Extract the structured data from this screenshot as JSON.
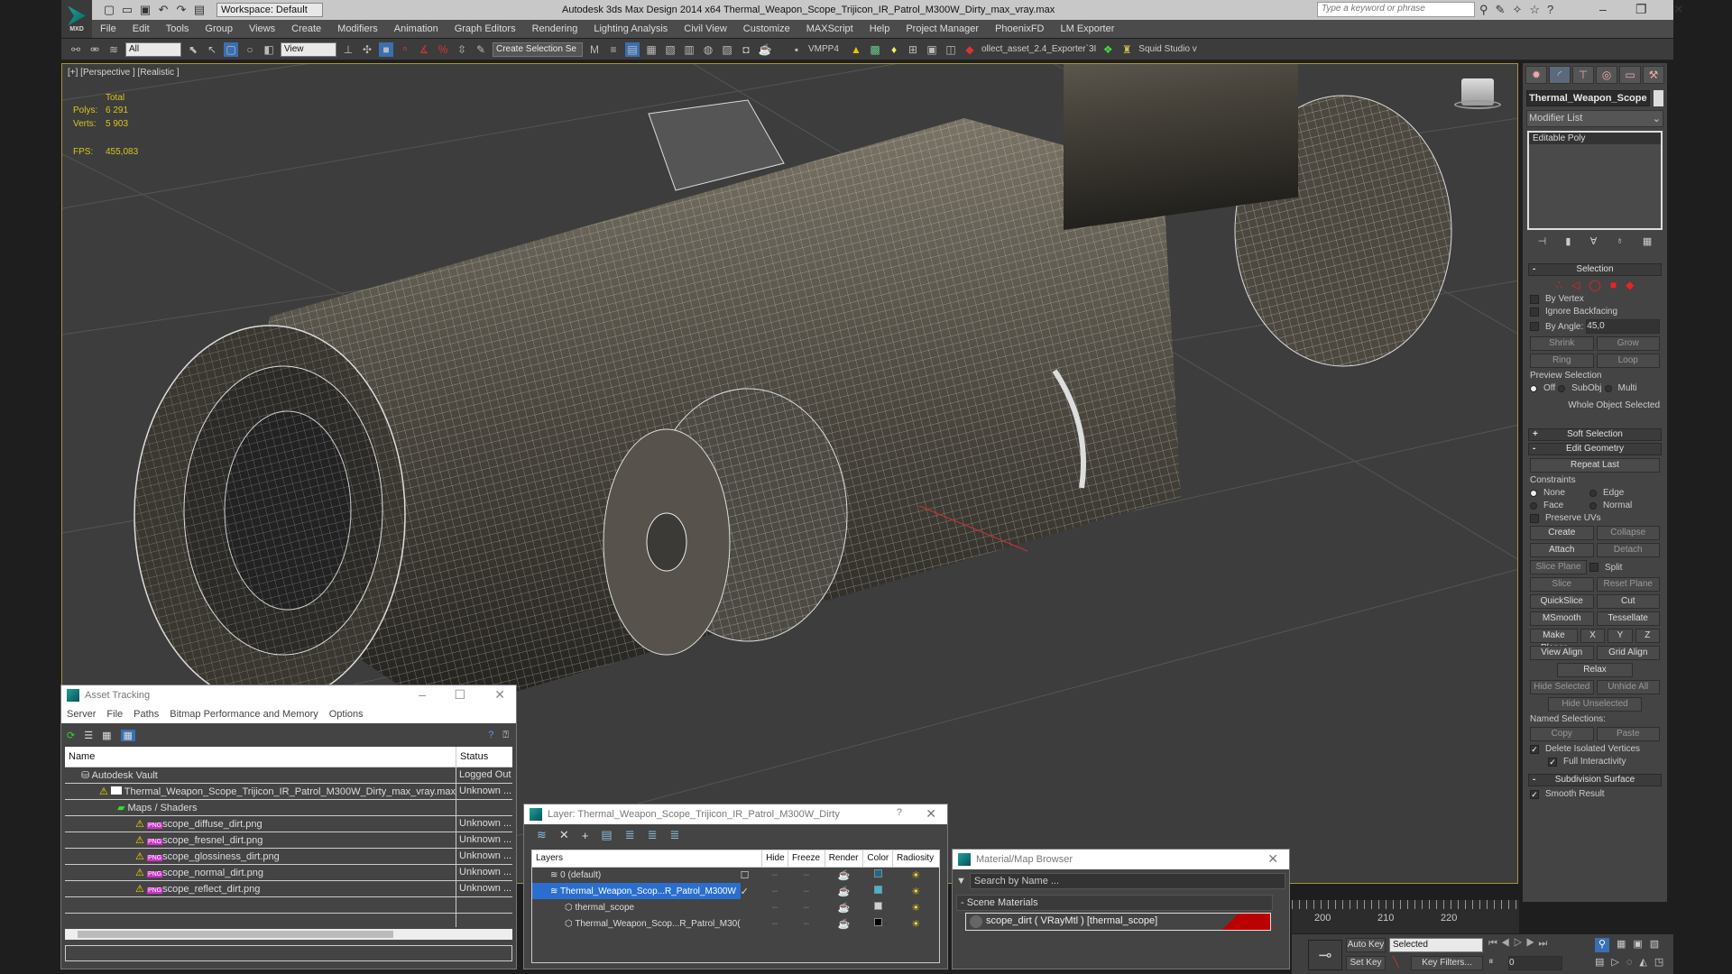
{
  "app": {
    "logo_text": "MXD",
    "workspace": "Workspace: Default",
    "title": "Autodesk 3ds Max Design 2014 x64    Thermal_Weapon_Scope_Trijicon_IR_Patrol_M300W_Dirty_max_vray.max",
    "search_placeholder": "Type a keyword or phrase"
  },
  "menu": [
    "File",
    "Edit",
    "Tools",
    "Group",
    "Views",
    "Create",
    "Modifiers",
    "Animation",
    "Graph Editors",
    "Rendering",
    "Lighting Analysis",
    "Civil View",
    "Customize",
    "MAXScript",
    "Help",
    "Project Manager",
    "PhoenixFD",
    "LM Exporter"
  ],
  "toolbar": {
    "filter": "All",
    "refcoord": "View",
    "selset": "Create Selection Se",
    "vmpp": "VMPP4",
    "exporter": "ollect_asset_2.4_Exporter`3I",
    "squid": "Squid Studio v"
  },
  "viewport": {
    "label": "[+] [Perspective ] [Realistic ]",
    "stats": {
      "total": "Total",
      "polys_label": "Polys:",
      "polys": "6 291",
      "verts_label": "Verts:",
      "verts": "5 903",
      "fps_label": "FPS:",
      "fps": "455,083"
    }
  },
  "command_panel": {
    "object_name": "Thermal_Weapon_Scope",
    "modifier_list": "Modifier List",
    "stack": [
      "Editable Poly"
    ],
    "selection": {
      "title": "Selection",
      "by_vertex": "By Vertex",
      "ignore_backfacing": "Ignore Backfacing",
      "by_angle": "By Angle:",
      "angle": "45,0",
      "shrink": "Shrink",
      "grow": "Grow",
      "ring": "Ring",
      "loop": "Loop",
      "preview": "Preview Selection",
      "off": "Off",
      "subobj": "SubObj",
      "multi": "Multi",
      "status": "Whole Object Selected"
    },
    "soft_selection": "Soft Selection",
    "edit_geometry": {
      "title": "Edit Geometry",
      "repeat_last": "Repeat Last",
      "constraints": "Constraints",
      "none": "None",
      "edge": "Edge",
      "face": "Face",
      "normal": "Normal",
      "preserve_uvs": "Preserve UVs",
      "create": "Create",
      "collapse": "Collapse",
      "attach": "Attach",
      "detach": "Detach",
      "slice_plane": "Slice Plane",
      "split": "Split",
      "slice": "Slice",
      "reset_plane": "Reset Plane",
      "quickslice": "QuickSlice",
      "cut": "Cut",
      "msmooth": "MSmooth",
      "tessellate": "Tessellate",
      "make_planar": "Make Planar",
      "x": "X",
      "y": "Y",
      "z": "Z",
      "view_align": "View Align",
      "grid_align": "Grid Align",
      "relax": "Relax",
      "hide_selected": "Hide Selected",
      "unhide_all": "Unhide All",
      "hide_unselected": "Hide Unselected",
      "named_selections": "Named Selections:",
      "copy": "Copy",
      "paste": "Paste",
      "delete_isolated": "Delete Isolated Vertices",
      "full_interactivity": "Full Interactivity"
    },
    "subdivision": {
      "title": "Subdivision Surface",
      "smooth_result": "Smooth Result"
    }
  },
  "asset_tracking": {
    "title": "Asset Tracking",
    "menu": [
      "Server",
      "File",
      "Paths",
      "Bitmap Performance and Memory",
      "Options"
    ],
    "col_name": "Name",
    "col_status": "Status",
    "rows": [
      {
        "name": "Autodesk Vault",
        "status": "Logged Out",
        "indent": 0
      },
      {
        "name": "Thermal_Weapon_Scope_Trijicon_IR_Patrol_M300W_Dirty_max_vray.max",
        "status": "Unknown ...",
        "indent": 1
      },
      {
        "name": "Maps / Shaders",
        "status": "",
        "indent": 2
      },
      {
        "name": "scope_diffuse_dirt.png",
        "status": "Unknown ...",
        "indent": 3
      },
      {
        "name": "scope_fresnel_dirt.png",
        "status": "Unknown ...",
        "indent": 3
      },
      {
        "name": "scope_glossiness_dirt.png",
        "status": "Unknown ...",
        "indent": 3
      },
      {
        "name": "scope_normal_dirt.png",
        "status": "Unknown ...",
        "indent": 3
      },
      {
        "name": "scope_reflect_dirt.png",
        "status": "Unknown ...",
        "indent": 3
      }
    ],
    "png_badge": "PNG"
  },
  "layer_dialog": {
    "title": "Layer: Thermal_Weapon_Scope_Trijicon_IR_Patrol_M300W_Dirty",
    "help": "?",
    "cols": [
      "Layers",
      "Hide",
      "Freeze",
      "Render",
      "Color",
      "Radiosity"
    ],
    "rows": [
      {
        "name": "0 (default)",
        "color": "#1a6a8a"
      },
      {
        "name": "Thermal_Weapon_Scop...R_Patrol_M300W",
        "color": "#3ab8d8",
        "selected": true
      },
      {
        "name": "thermal_scope",
        "color": "#d0d0d0"
      },
      {
        "name": "Thermal_Weapon_Scop...R_Patrol_M30(",
        "color": "#000000"
      }
    ]
  },
  "material_browser": {
    "title": "Material/Map Browser",
    "search_placeholder": "Search by Name ...",
    "section": "Scene Materials",
    "item": "scope_dirt  ( VRayMtl ) [thermal_scope]"
  },
  "timeline": {
    "ticks": [
      "200",
      "210",
      "220"
    ]
  },
  "anim": {
    "auto_key": "Auto Key",
    "set_key": "Set Key",
    "selected": "Selected",
    "key_filters": "Key Filters...",
    "frame": "0"
  }
}
